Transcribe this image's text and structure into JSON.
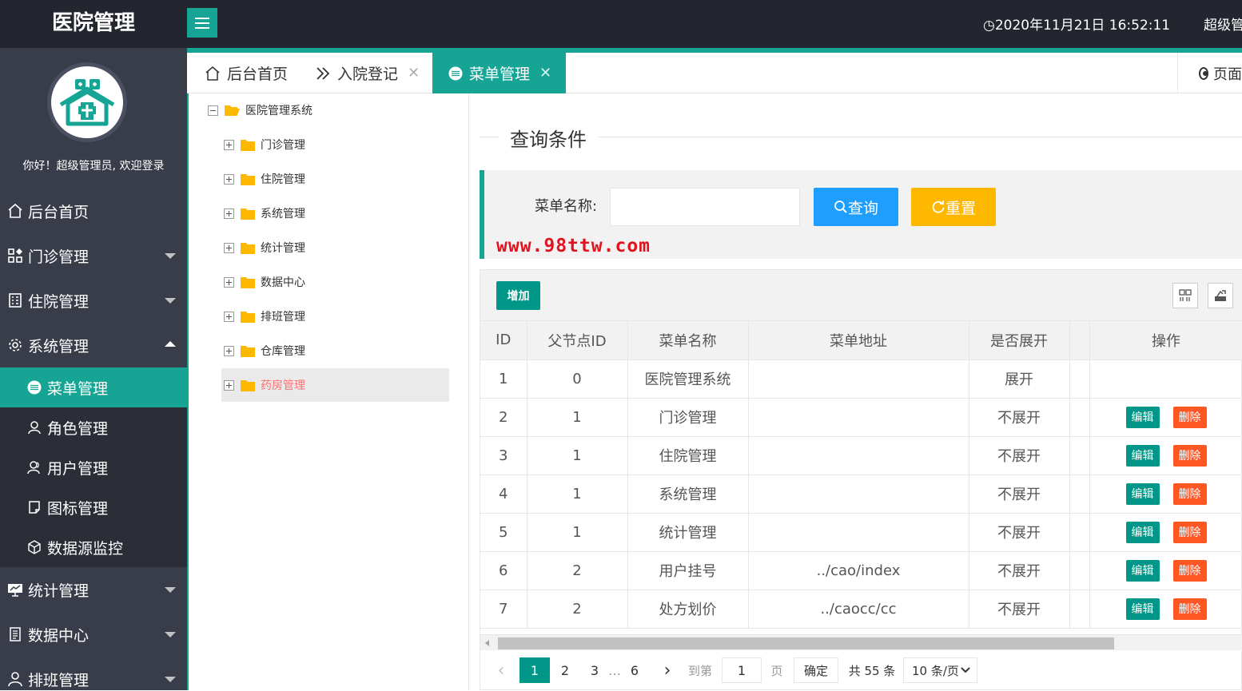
{
  "app": {
    "title": "医院管理",
    "clock": "2020年11月21日 16:52:11",
    "user_menu": "超级管"
  },
  "sidebar": {
    "welcome": "你好！超级管理员, 欢迎登录",
    "items": [
      {
        "label": "后台首页",
        "icon": "home-icon"
      },
      {
        "label": "门诊管理",
        "icon": "apps-icon"
      },
      {
        "label": "住院管理",
        "icon": "building-icon"
      },
      {
        "label": "系统管理",
        "icon": "gear-icon"
      },
      {
        "label": "统计管理",
        "icon": "chart-board-icon"
      },
      {
        "label": "数据中心",
        "icon": "document-icon"
      },
      {
        "label": "排班管理",
        "icon": "person-icon"
      }
    ],
    "sub_items": [
      {
        "label": "菜单管理",
        "icon": "circle-menu-icon"
      },
      {
        "label": "角色管理",
        "icon": "user-icon"
      },
      {
        "label": "用户管理",
        "icon": "users-icon"
      },
      {
        "label": "图标管理",
        "icon": "note-icon"
      },
      {
        "label": "数据源监控",
        "icon": "cube-icon"
      }
    ]
  },
  "tabs": [
    {
      "label": "后台首页",
      "icon": "home-icon"
    },
    {
      "label": "入院登记",
      "icon": "double-chevron-icon"
    },
    {
      "label": "菜单管理",
      "icon": "circle-menu-icon"
    }
  ],
  "page_ops": "页面",
  "tree": {
    "root": "医院管理系统",
    "children": [
      "门诊管理",
      "住院管理",
      "系统管理",
      "统计管理",
      "数据中心",
      "排班管理",
      "仓库管理",
      "药房管理"
    ]
  },
  "query": {
    "legend": "查询条件",
    "label": "菜单名称:",
    "value": "",
    "search": "查询",
    "reset": "重置",
    "watermark": "www.98ttw.com"
  },
  "table": {
    "add": "增加",
    "columns": [
      "ID",
      "父节点ID",
      "菜单名称",
      "菜单地址",
      "是否展开",
      "",
      "操作"
    ],
    "rows": [
      {
        "id": "1",
        "pid": "0",
        "name": "医院管理系统",
        "url": "",
        "open": "展开",
        "ops": false
      },
      {
        "id": "2",
        "pid": "1",
        "name": "门诊管理",
        "url": "",
        "open": "不展开",
        "ops": true
      },
      {
        "id": "3",
        "pid": "1",
        "name": "住院管理",
        "url": "",
        "open": "不展开",
        "ops": true
      },
      {
        "id": "4",
        "pid": "1",
        "name": "系统管理",
        "url": "",
        "open": "不展开",
        "ops": true
      },
      {
        "id": "5",
        "pid": "1",
        "name": "统计管理",
        "url": "",
        "open": "不展开",
        "ops": true
      },
      {
        "id": "6",
        "pid": "2",
        "name": "用户挂号",
        "url": "../cao/index",
        "open": "不展开",
        "ops": true
      },
      {
        "id": "7",
        "pid": "2",
        "name": "处方划价",
        "url": "../caocc/cc",
        "open": "不展开",
        "ops": true
      }
    ],
    "edit": "编辑",
    "delete": "删除"
  },
  "pager": {
    "pages": [
      "1",
      "2",
      "3",
      "…",
      "6"
    ],
    "goto": "到第",
    "page_input": "1",
    "page_unit": "页",
    "ok": "确定",
    "total": "共 55 条",
    "size": "10 条/页"
  },
  "colors": {
    "accent": "#16a595",
    "sidebar": "#393d49",
    "topbar": "#23262e",
    "search": "#1e9fff",
    "reset": "#ffb800",
    "danger": "#ff5722"
  }
}
